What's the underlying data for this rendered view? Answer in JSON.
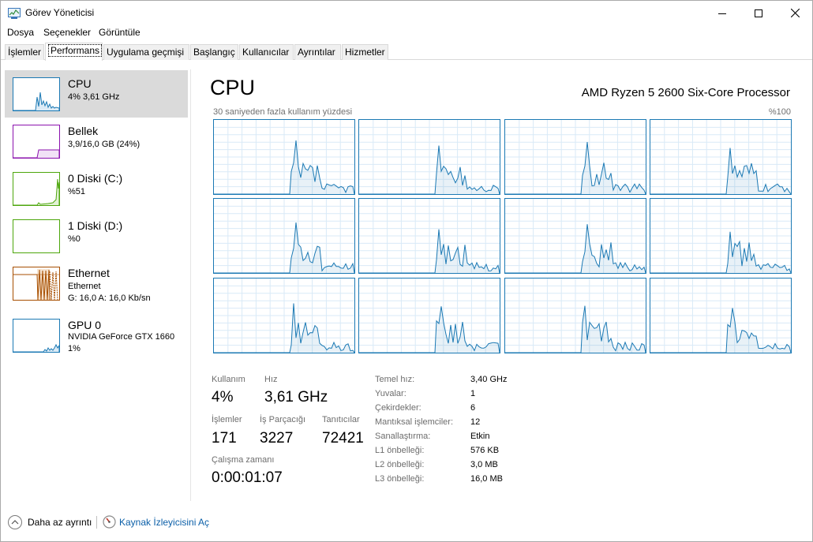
{
  "window": {
    "title": "Görev Yöneticisi",
    "controls": {
      "minimize": "minimize-icon",
      "maximize": "maximize-icon",
      "close": "close-icon"
    }
  },
  "menu": [
    "Dosya",
    "Seçenekler",
    "Görüntüle"
  ],
  "tabs": [
    "İşlemler",
    "Performans",
    "Uygulama geçmişi",
    "Başlangıç",
    "Kullanıcılar",
    "Ayrıntılar",
    "Hizmetler"
  ],
  "active_tab": "Performans",
  "sidebar": [
    {
      "name": "CPU",
      "line1": "4% 3,61 GHz",
      "color": "#1b79b4"
    },
    {
      "name": "Bellek",
      "line1": "3,9/16,0 GB (24%)",
      "color": "#8b12ae"
    },
    {
      "name": "0 Diski (C:)",
      "line1": "%51",
      "color": "#4da60c"
    },
    {
      "name": "1 Diski (D:)",
      "line1": "%0",
      "color": "#4da60c"
    },
    {
      "name": "Ethernet",
      "line1": "Ethernet",
      "line2": "G: 16,0  A: 16,0 Kb/sn",
      "color": "#a74f01"
    },
    {
      "name": "GPU 0",
      "line1": "NVIDIA GeForce GTX 1660",
      "line2": "1%",
      "color": "#1b79b4"
    }
  ],
  "main": {
    "title": "CPU",
    "processor": "AMD Ryzen 5 2600 Six-Core Processor",
    "graph_label": "30 saniyeden fazla kullanım yüzdesi",
    "graph_max": "%100",
    "accent_color": "#1b79b4"
  },
  "stats": {
    "usage_label": "Kullanım",
    "usage_value": "4%",
    "speed_label": "Hız",
    "speed_value": "3,61 GHz",
    "processes_label": "İşlemler",
    "processes_value": "171",
    "threads_label": "İş Parçacığı",
    "threads_value": "3227",
    "handles_label": "Tanıtıcılar",
    "handles_value": "72421",
    "uptime_label": "Çalışma zamanı",
    "uptime_value": "0:00:01:07"
  },
  "specs": [
    {
      "label": "Temel hız:",
      "value": "3,40 GHz"
    },
    {
      "label": "Yuvalar:",
      "value": "1"
    },
    {
      "label": "Çekirdekler:",
      "value": "6"
    },
    {
      "label": "Mantıksal işlemciler:",
      "value": "12"
    },
    {
      "label": "Sanallaştırma:",
      "value": "Etkin"
    },
    {
      "label": "L1 önbelleği:",
      "value": "576 KB"
    },
    {
      "label": "L2 önbelleği:",
      "value": "3,0 MB"
    },
    {
      "label": "L3 önbelleği:",
      "value": "16,0 MB"
    }
  ],
  "footer": {
    "fewer_details": "Daha az ayrıntı",
    "resource_monitor": "Kaynak İzleyicisini Aç"
  }
}
